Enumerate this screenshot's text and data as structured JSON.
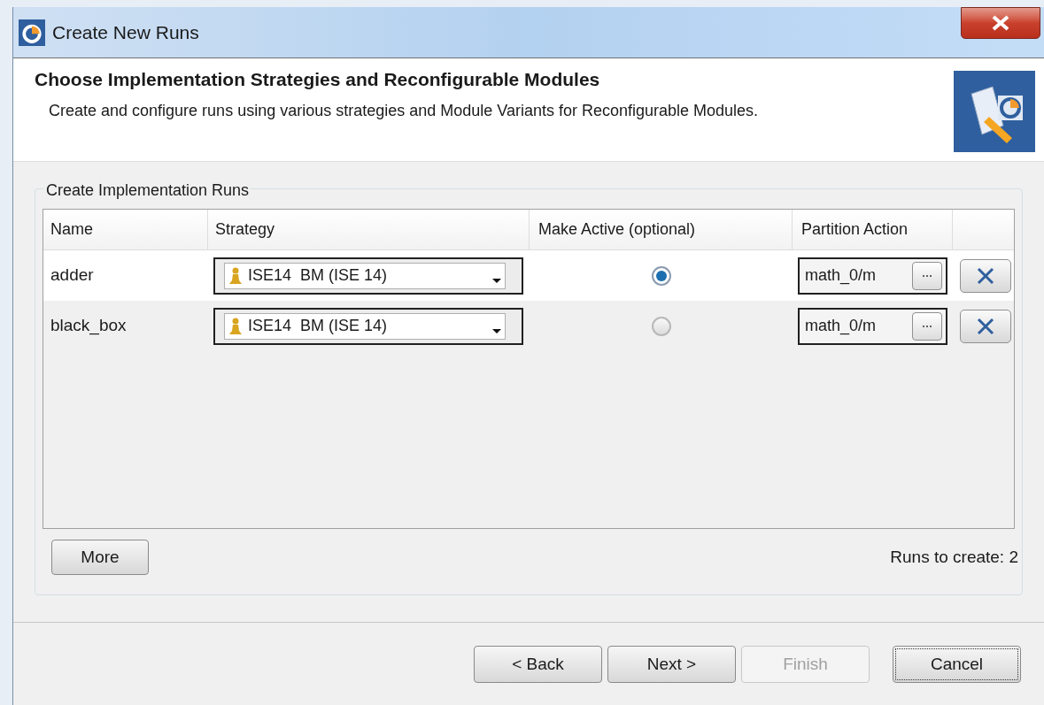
{
  "window": {
    "title": "Create New Runs"
  },
  "header": {
    "title": "Choose Implementation Strategies and Reconfigurable Modules",
    "description": "Create and configure runs using various strategies and Module Variants for Reconfigurable Modules."
  },
  "group": {
    "title": "Create Implementation Runs"
  },
  "table": {
    "columns": [
      "Name",
      "Strategy",
      "Make Active (optional)",
      "Partition Action"
    ],
    "rows": [
      {
        "name": "adder",
        "strategy": "ISE14  BM (ISE 14)",
        "active": true,
        "partition": "math_0/m"
      },
      {
        "name": "black_box",
        "strategy": "ISE14  BM (ISE 14)",
        "active": false,
        "partition": "math_0/m"
      }
    ]
  },
  "more_button": "More",
  "runs_count": "Runs to create: 2",
  "buttons": [
    {
      "label": "< Back",
      "disabled": false,
      "focused": false
    },
    {
      "label": "Next >",
      "disabled": false,
      "focused": false
    },
    {
      "label": "Finish",
      "disabled": true,
      "focused": false
    },
    {
      "label": "Cancel",
      "disabled": false,
      "focused": true
    }
  ]
}
